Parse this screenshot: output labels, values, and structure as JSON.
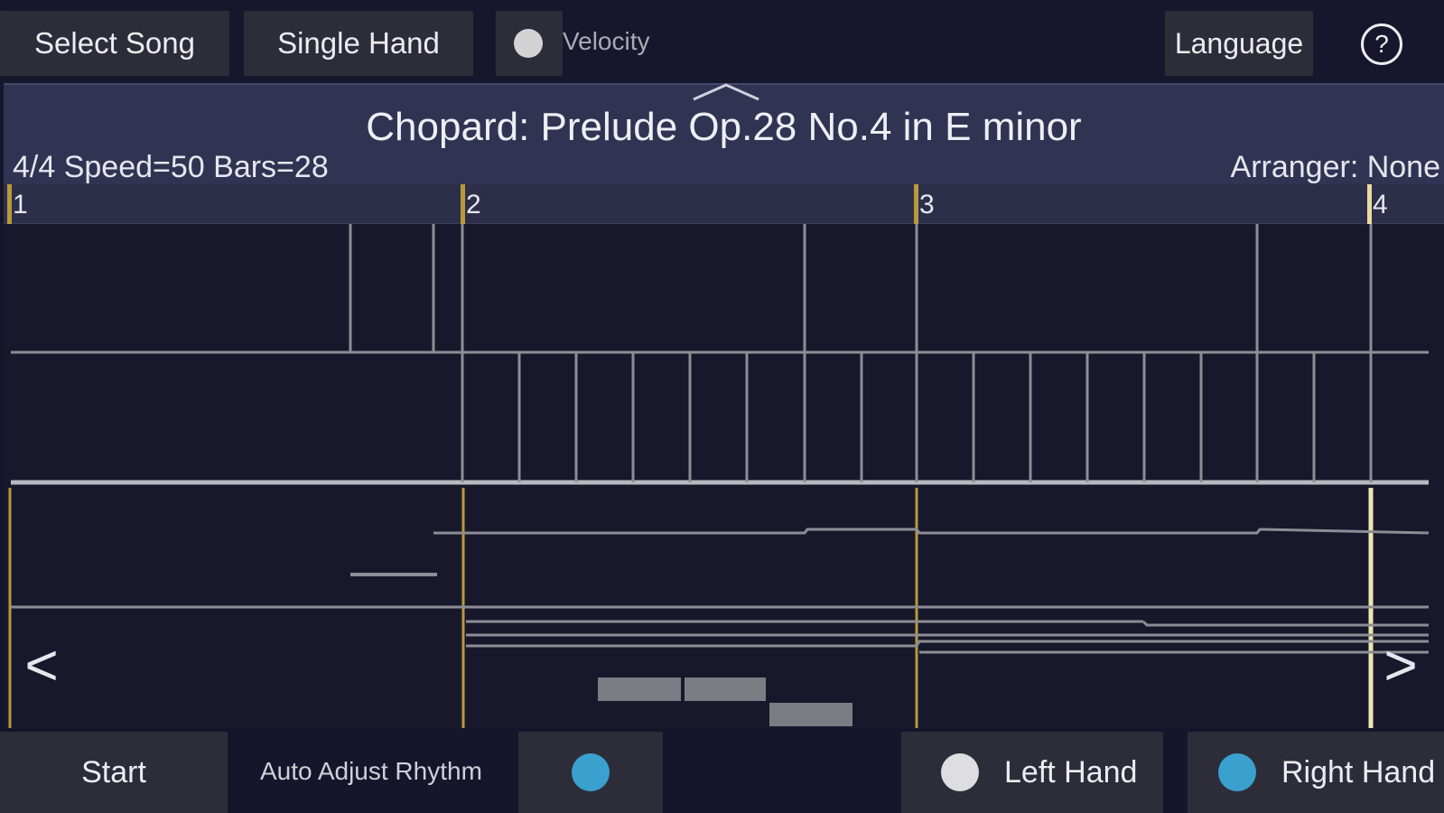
{
  "toolbar": {
    "select_song_label": "Select Song",
    "single_hand_label": "Single Hand",
    "velocity_label": "Velocity",
    "velocity_enabled": false,
    "language_label": "Language",
    "help_label": "?"
  },
  "song": {
    "title": "Chopard: Prelude Op.28 No.4 in E minor",
    "meta": "4/4 Speed=50 Bars=28",
    "arranger": "Arranger: None"
  },
  "ruler": {
    "bars": [
      "1",
      "2",
      "3",
      "4"
    ]
  },
  "navigation": {
    "prev_label": "<",
    "next_label": ">"
  },
  "bottombar": {
    "start_label": "Start",
    "auto_adjust_label": "Auto Adjust Rhythm",
    "auto_adjust_enabled": true,
    "left_hand_label": "Left Hand",
    "left_hand_enabled": false,
    "right_hand_label": "Right Hand",
    "right_hand_enabled": true
  },
  "colors": {
    "background": "#15162b",
    "header": "#313353",
    "button": "#2c2d38",
    "accent_blue": "#3aa1cf",
    "bar_line_gold": "#b89a3a",
    "staff_line": "#8d8d96"
  }
}
